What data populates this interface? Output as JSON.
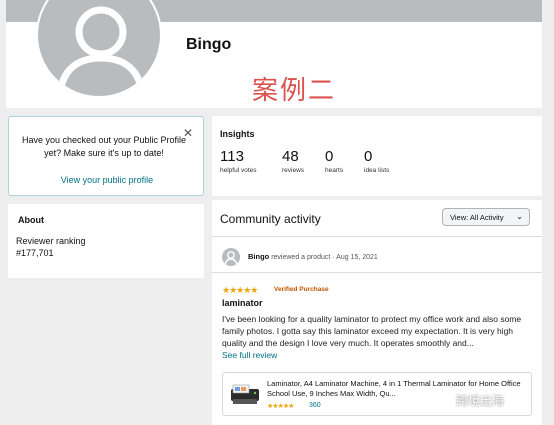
{
  "profile": {
    "name": "Bingo",
    "overlay_label": "案例二"
  },
  "public_profile_prompt": {
    "message": "Have you checked out your Public Profile yet? Make sure it's up to date!",
    "link": "View your public profile",
    "close_glyph": "✕"
  },
  "about": {
    "title": "About",
    "ranking_label": "Reviewer ranking",
    "ranking_value": "#177,701"
  },
  "insights": {
    "title": "Insights",
    "stats": [
      {
        "value": "113",
        "label": "helpful votes"
      },
      {
        "value": "48",
        "label": "reviews"
      },
      {
        "value": "0",
        "label": "hearts"
      },
      {
        "value": "0",
        "label": "idea lists"
      }
    ]
  },
  "activity": {
    "title": "Community activity",
    "filter_label": "View: All Activity",
    "entry": {
      "user": "Bingo",
      "action": "reviewed a product · Aug 15, 2021",
      "rating": 5,
      "stars_glyph": "★★★★★",
      "badge": "Verified Purchase",
      "review_title": "laminator",
      "review_body": "I've been looking for a quality laminator to protect my office work and also some family photos. I gotta say this laminator exceed my expectation. It is very high quality and the design I love very much. It operates smoothly and...",
      "see_full": "See full review",
      "product": {
        "name": "Laminator, A4 Laminator Machine, 4 in 1 Thermal Laminator for Home Office School Use, 9 Inches Max Width, Qu...",
        "rating": 4.5,
        "stars_glyph": "★★★★★",
        "rating_count": "360"
      }
    }
  },
  "watermark": {
    "text": "跨境出海"
  },
  "colors": {
    "link": "#007185",
    "star": "#f0a40e",
    "badge": "#c45500",
    "overlay_text": "#d9534f"
  }
}
